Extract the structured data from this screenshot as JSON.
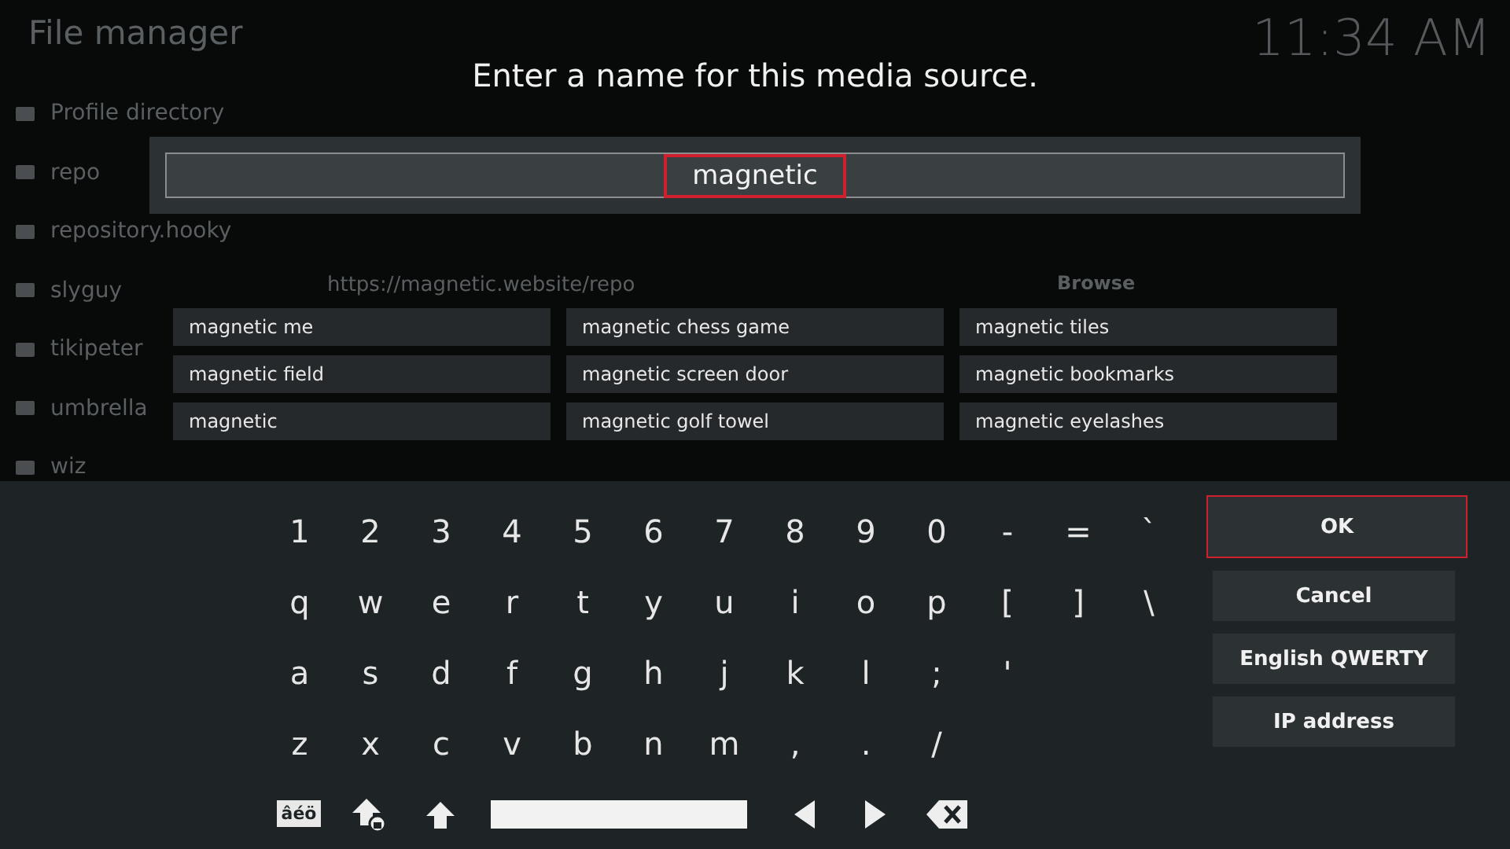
{
  "background": {
    "title": "File manager",
    "clock": "11:34 AM",
    "sidebar_items": [
      "Profile directory",
      "repo",
      "repository.hooky",
      "slyguy",
      "tikipeter",
      "umbrella",
      "wiz"
    ],
    "url": "https://magnetic.website/repo",
    "browse": "Browse"
  },
  "dialog": {
    "heading": "Enter a name for this media source.",
    "input": {
      "value": "magnetic",
      "focused": true
    },
    "suggestions": [
      [
        "magnetic me",
        "magnetic chess game",
        "magnetic tiles"
      ],
      [
        "magnetic field",
        "magnetic screen door",
        "magnetic bookmarks"
      ],
      [
        "magnetic",
        "magnetic golf towel",
        "magnetic eyelashes"
      ]
    ]
  },
  "keyboard": {
    "rows": [
      [
        "1",
        "2",
        "3",
        "4",
        "5",
        "6",
        "7",
        "8",
        "9",
        "0",
        "-",
        "=",
        "`"
      ],
      [
        "q",
        "w",
        "e",
        "r",
        "t",
        "y",
        "u",
        "i",
        "o",
        "p",
        "[",
        "]",
        "\\"
      ],
      [
        "a",
        "s",
        "d",
        "f",
        "g",
        "h",
        "j",
        "k",
        "l",
        ";",
        "'"
      ],
      [
        "z",
        "x",
        "c",
        "v",
        "b",
        "n",
        "m",
        ",",
        ".",
        "/"
      ]
    ],
    "symbols_key": "âéö",
    "actions": [
      {
        "label": "OK",
        "focused": true
      },
      {
        "label": "Cancel",
        "focused": false
      },
      {
        "label": "English QWERTY",
        "focused": false
      },
      {
        "label": "IP address",
        "focused": false
      }
    ]
  }
}
